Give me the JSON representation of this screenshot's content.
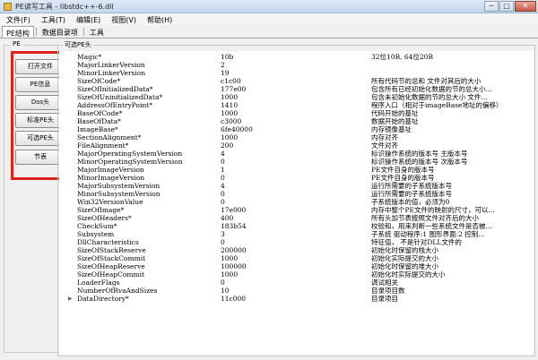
{
  "window": {
    "title": "PE读写工具 - libstdc++-6.dll",
    "minimize": "─",
    "maximize": "□",
    "close": "✕"
  },
  "menu": [
    "文件(F)",
    "工具(T)",
    "编辑(E)",
    "视图(V)",
    "帮助(H)"
  ],
  "tabs": [
    "PE结构",
    "数据目录项",
    "工具"
  ],
  "left_group": {
    "label": "PE",
    "buttons": [
      "打开文件",
      "PE信息",
      "Dos头",
      "标准PE头",
      "可选PE头",
      "节表"
    ]
  },
  "right_group": {
    "label": "可选PE头"
  },
  "rows": [
    {
      "name": "Magic*",
      "value": "10b",
      "desc": "32位10B, 64位20B"
    },
    {
      "name": "MajorLinkerVersion",
      "value": "2",
      "desc": ""
    },
    {
      "name": "MinorLinkerVersion",
      "value": "19",
      "desc": ""
    },
    {
      "name": "SizeOfCode*",
      "value": "c1c00",
      "desc": "所有代码节的总和 文件对其后的大小"
    },
    {
      "name": "SizeOfInitializedData*",
      "value": "177e00",
      "desc": "包含所有已经初始化数据的节的总大小..."
    },
    {
      "name": "SizeOfUninitializedData*",
      "value": "1000",
      "desc": "包含未初始化数据的节的总大小 文件..."
    },
    {
      "name": "AddressOfEntryPoint*",
      "value": "1410",
      "desc": "程序入口（相对于imageBase地址的偏移）"
    },
    {
      "name": "BaseOfCode*",
      "value": "1000",
      "desc": "代码开始的基址"
    },
    {
      "name": "BaseOfData*",
      "value": "c3000",
      "desc": "数据开始的基址"
    },
    {
      "name": "ImageBase*",
      "value": "6fe40000",
      "desc": "内存镜像基址"
    },
    {
      "name": "SectionAlignment*",
      "value": "1000",
      "desc": "内存对齐"
    },
    {
      "name": "FileAlignment*",
      "value": "200",
      "desc": "文件对齐"
    },
    {
      "name": "MajorOperatingSystemVersion",
      "value": "4",
      "desc": "标识操作系统的版本号 主版本号"
    },
    {
      "name": "MinorOperatingSystemVersion",
      "value": "0",
      "desc": "标识操作系统的版本号 次版本号"
    },
    {
      "name": "MajorImageVersion",
      "value": "1",
      "desc": "PE文件自身的版本号"
    },
    {
      "name": "MinorImageVersion",
      "value": "0",
      "desc": "PE文件自身的版本号"
    },
    {
      "name": "MajorSubsystemVersion",
      "value": "4",
      "desc": "运行所需要的子系统版本号"
    },
    {
      "name": "MinorSubsystemVersion",
      "value": "0",
      "desc": "运行所需要的子系统版本号"
    },
    {
      "name": "Win32VersionValue",
      "value": "0",
      "desc": "子系统版本的值，必须为0"
    },
    {
      "name": "SizeOfImage*",
      "value": "17e000",
      "desc": "内存中整个PE文件的映射的尺寸，可以..."
    },
    {
      "name": "SizeOfHeaders*",
      "value": "400",
      "desc": "所有头加节表按照文件对齐后的大小"
    },
    {
      "name": "CheckSum*",
      "value": "183b54",
      "desc": "校验和，用来判断一些系统文件是否被..."
    },
    {
      "name": "Subsystem",
      "value": "3",
      "desc": "子系统 驱动程序:1 图形界面:2 控制..."
    },
    {
      "name": "DllCharacteristics",
      "value": "0",
      "desc": "特征值， 不是针对DLL文件的"
    },
    {
      "name": "SizeOfStackReserve",
      "value": "200000",
      "desc": "初始化时保留的栈大小"
    },
    {
      "name": "SizeOfStackCommit",
      "value": "1000",
      "desc": "初始化实际提交的大小"
    },
    {
      "name": "SizeOfHeapReserve",
      "value": "100000",
      "desc": "初始化时保留的堆大小"
    },
    {
      "name": "SizeOfHeapCommit",
      "value": "1000",
      "desc": "初始化时实际提交的大小"
    },
    {
      "name": "LoaderFlags",
      "value": "0",
      "desc": "调试相关"
    },
    {
      "name": "NumberOfRvaAndSizes",
      "value": "10",
      "desc": "目录项目数"
    },
    {
      "name": "DataDirectory*",
      "value": "11c000",
      "desc": "目录项目",
      "expandable": true
    }
  ]
}
